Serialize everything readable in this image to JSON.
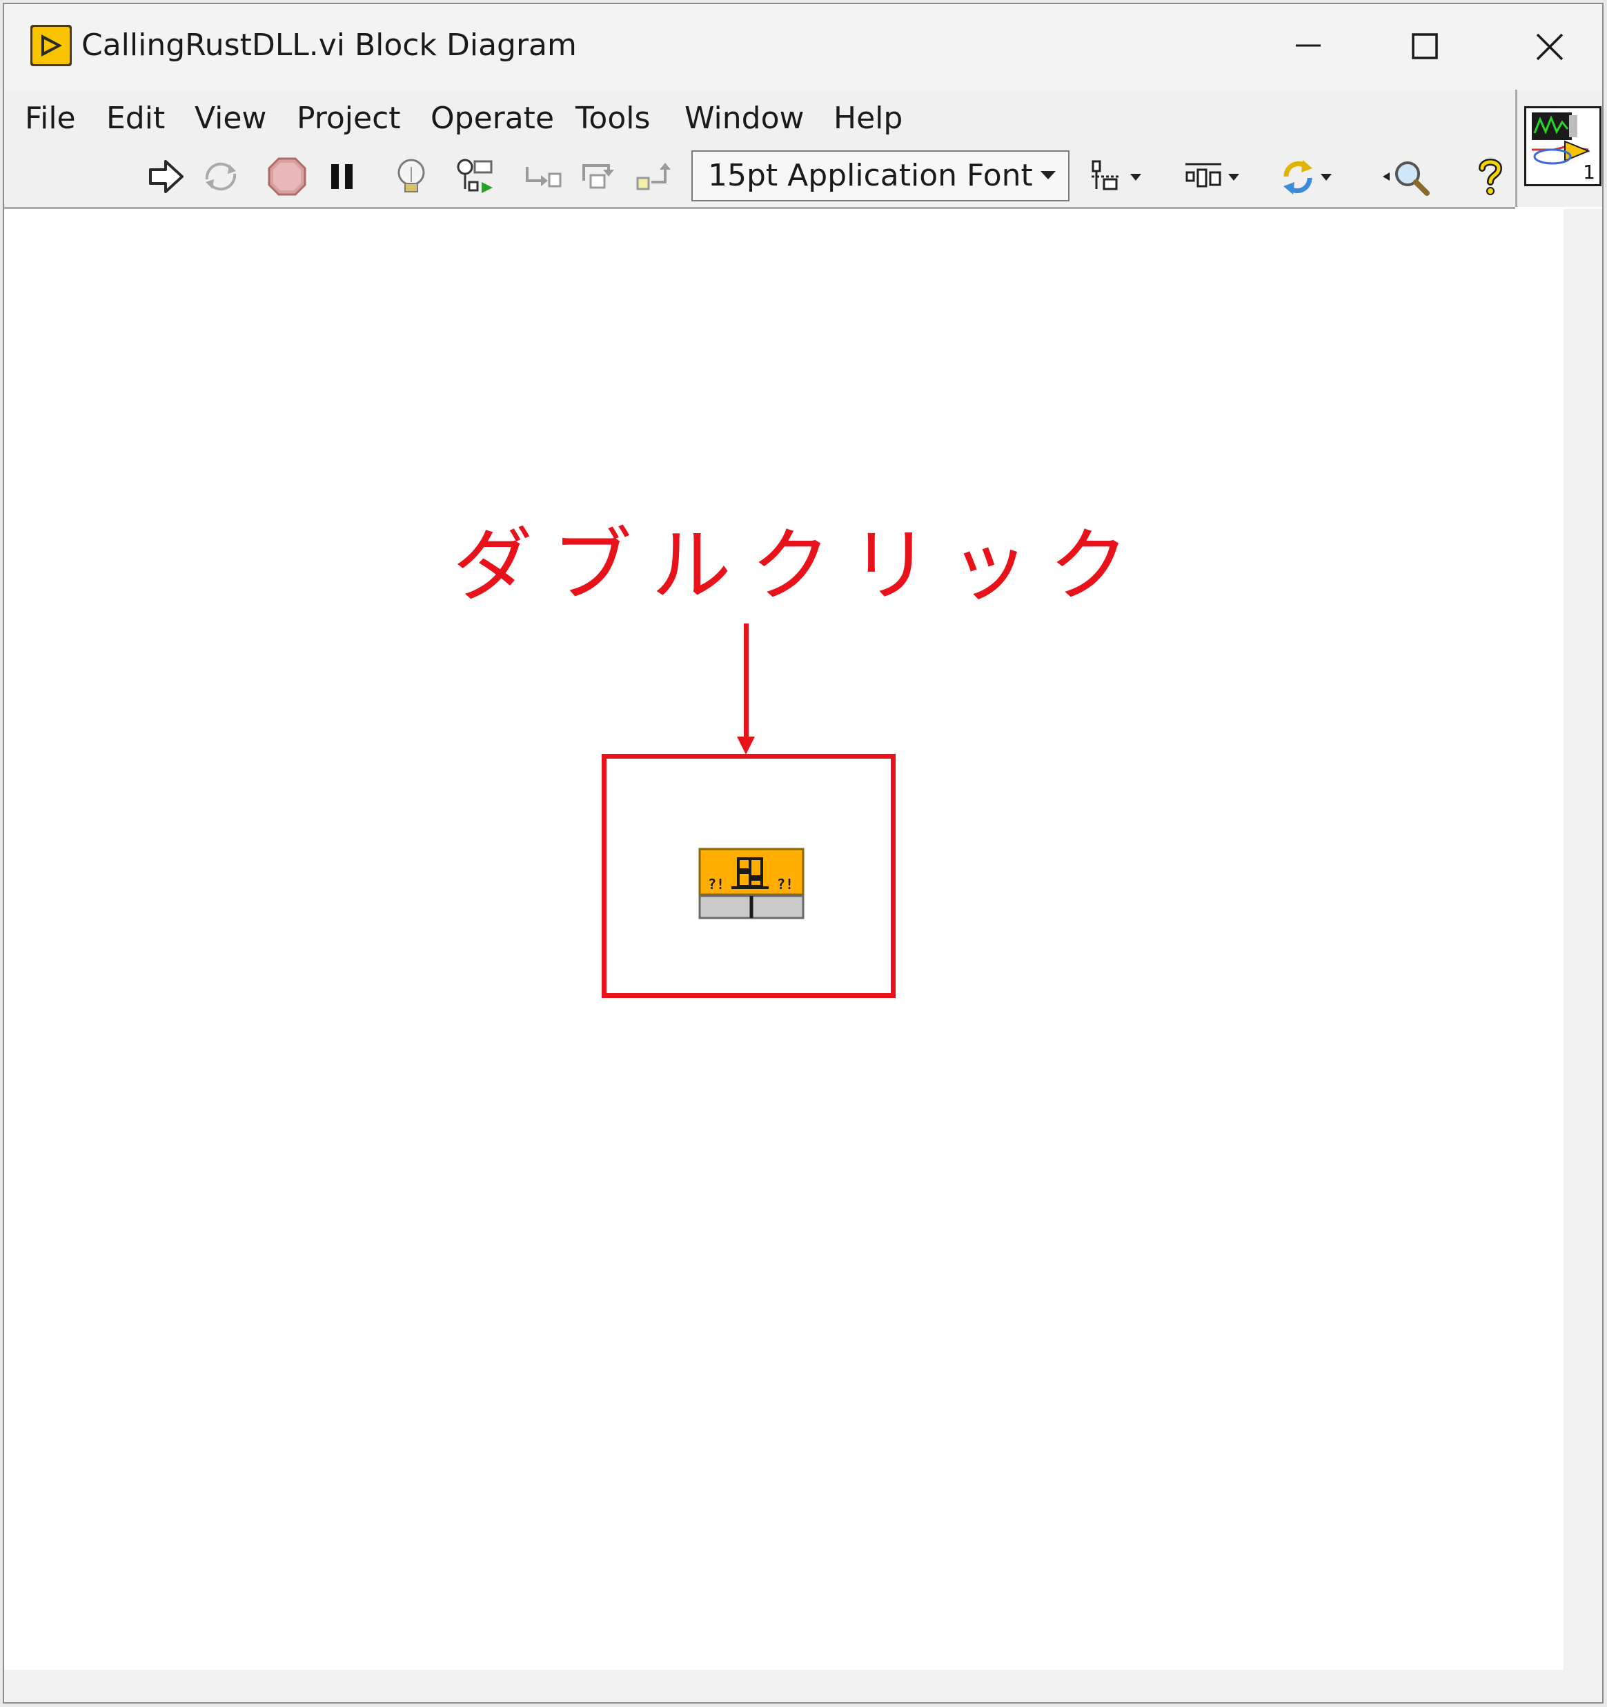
{
  "window": {
    "title": "CallingRustDLL.vi Block Diagram",
    "controls": [
      "minimize-icon",
      "maximize-icon",
      "close-icon"
    ]
  },
  "menu": {
    "items": [
      "File",
      "Edit",
      "View",
      "Project",
      "Operate",
      "Tools",
      "Window",
      "Help"
    ]
  },
  "toolbar": {
    "font_select_value": "15pt Application Font",
    "icons": [
      "run-arrow-icon",
      "run-continuously-icon",
      "abort-icon",
      "pause-icon",
      "highlight-execution-icon",
      "retain-wire-values-icon",
      "step-into-icon",
      "step-over-icon",
      "step-out-icon",
      "align-objects-icon",
      "distribute-objects-icon",
      "reorder-icon",
      "search-icon",
      "help-icon"
    ]
  },
  "vi_icon": {
    "label": "1"
  },
  "annotation": {
    "text": "ダブルクリック",
    "color": "#e8131a"
  },
  "diagram": {
    "node": "call-library-function-node",
    "node_color": "#ffad00"
  }
}
